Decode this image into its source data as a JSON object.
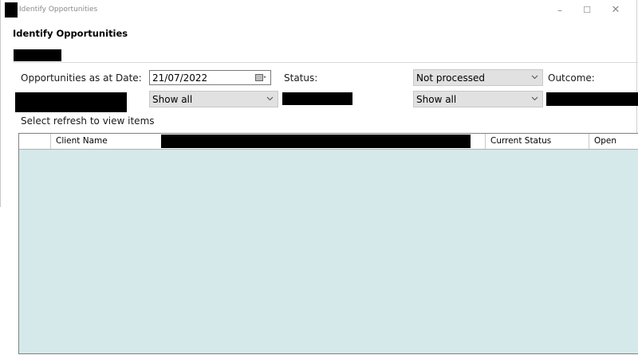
{
  "window": {
    "title": "Identify Opportunities",
    "controls": {
      "minimize": "–",
      "maximize": "☐",
      "close": "✕"
    }
  },
  "page": {
    "title": "Identify Opportunities"
  },
  "filters": {
    "opportunities_date_label": "Opportunities as at Date:",
    "opportunities_date_value": "21/07/2022",
    "status_label": "Status:",
    "status_value": "Not processed",
    "outcome_label": "Outcome:",
    "filter_1_value": "Show all",
    "filter_2_value": "Show all"
  },
  "hint": "Select refresh to view items",
  "grid": {
    "columns": [
      "",
      "Client Name",
      "Current Status",
      "Open"
    ],
    "rows": []
  },
  "colors": {
    "grid_background": "#d6e9ea",
    "combo_background": "#e1e1e1",
    "redaction": "#000000"
  },
  "icons": {
    "calendar": "calendar-icon",
    "dropdown": "chevron-down-icon"
  }
}
